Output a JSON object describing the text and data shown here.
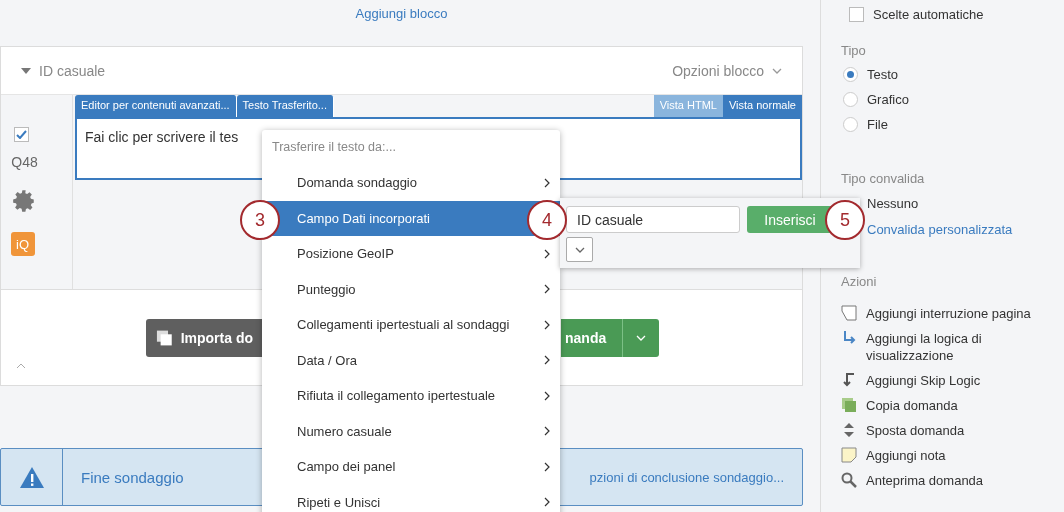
{
  "add_block_link": "Aggiungi blocco",
  "block": {
    "title": "ID casuale",
    "options": "Opzioni blocco",
    "expanded": true
  },
  "question": {
    "number": "Q48",
    "checked": true,
    "iq_badge": "iQ",
    "editor_tabs": [
      {
        "label": "Editor per contenuti avanzati..."
      },
      {
        "label": "Testo Trasferito..."
      }
    ],
    "view_tabs": [
      {
        "label": "Vista HTML",
        "selected": false
      },
      {
        "label": "Vista normale",
        "selected": true
      }
    ],
    "text": "Fai clic per scrivere il tes"
  },
  "block_buttons": {
    "import": "Importa do",
    "new": "nanda"
  },
  "end_bar": {
    "title": "Fine sondaggio",
    "link": "pzioni di conclusione sondaggio..."
  },
  "menu": {
    "header": "Trasferire il testo da:...",
    "items": [
      {
        "label": "Domanda sondaggio",
        "selected": false
      },
      {
        "label": "Campo Dati incorporati",
        "selected": true
      },
      {
        "label": "Posizione GeoIP",
        "selected": false
      },
      {
        "label": "Punteggio",
        "selected": false
      },
      {
        "label": "Collegamenti ipertestuali al sondaggi",
        "selected": false
      },
      {
        "label": "Data / Ora",
        "selected": false
      },
      {
        "label": "Rifiuta il collegamento ipertestuale",
        "selected": false
      },
      {
        "label": "Numero casuale",
        "selected": false
      },
      {
        "label": "Campo dei panel",
        "selected": false
      },
      {
        "label": "Ripeti e Unisci",
        "selected": false
      }
    ]
  },
  "submenu": {
    "field_value": "ID casuale",
    "insert_button": "Inserisci"
  },
  "callouts": [
    "3",
    "4",
    "5"
  ],
  "sidebar": {
    "auto_choices": {
      "label": "Scelte automatiche",
      "checked": false
    },
    "type_heading": "Tipo",
    "types": [
      {
        "label": "Testo",
        "selected": true
      },
      {
        "label": "Grafico",
        "selected": false
      },
      {
        "label": "File",
        "selected": false
      }
    ],
    "validation_heading": "Tipo convalida",
    "validation_option": "Nessuno",
    "validation_link": "Convalida personalizzata",
    "actions_heading": "Azioni",
    "actions": [
      "Aggiungi interruzione pagina",
      "Aggiungi la logica di visualizzazione",
      "Aggiungi Skip Logic",
      "Copia domanda",
      "Sposta domanda",
      "Aggiungi nota",
      "Anteprima domanda"
    ]
  }
}
